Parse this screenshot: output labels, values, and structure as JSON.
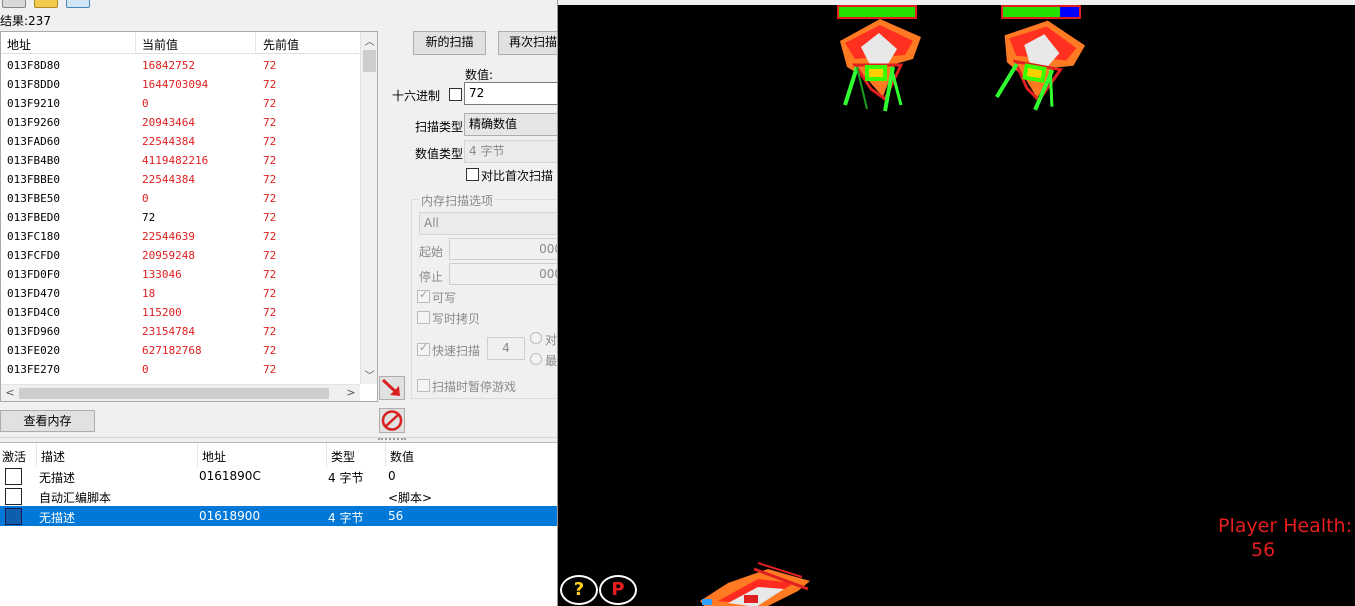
{
  "ce": {
    "results_label": "结果:237",
    "scan_list": {
      "columns": [
        "地址",
        "当前值",
        "先前值"
      ],
      "rows": [
        {
          "address": "013F8D80",
          "current": "16842752",
          "previous": "72",
          "changed": true
        },
        {
          "address": "013F8DD0",
          "current": "1644703094",
          "previous": "72",
          "changed": true
        },
        {
          "address": "013F9210",
          "current": "0",
          "previous": "72",
          "changed": true
        },
        {
          "address": "013F9260",
          "current": "20943464",
          "previous": "72",
          "changed": true
        },
        {
          "address": "013FAD60",
          "current": "22544384",
          "previous": "72",
          "changed": true
        },
        {
          "address": "013FB4B0",
          "current": "4119482216",
          "previous": "72",
          "changed": true
        },
        {
          "address": "013FBBE0",
          "current": "22544384",
          "previous": "72",
          "changed": true
        },
        {
          "address": "013FBE50",
          "current": "0",
          "previous": "72",
          "changed": true
        },
        {
          "address": "013FBED0",
          "current": "72",
          "previous": "72",
          "changed": false
        },
        {
          "address": "013FC180",
          "current": "22544639",
          "previous": "72",
          "changed": true
        },
        {
          "address": "013FCFD0",
          "current": "20959248",
          "previous": "72",
          "changed": true
        },
        {
          "address": "013FD0F0",
          "current": "133046",
          "previous": "72",
          "changed": true
        },
        {
          "address": "013FD470",
          "current": "18",
          "previous": "72",
          "changed": true
        },
        {
          "address": "013FD4C0",
          "current": "115200",
          "previous": "72",
          "changed": true
        },
        {
          "address": "013FD960",
          "current": "23154784",
          "previous": "72",
          "changed": true
        },
        {
          "address": "013FE020",
          "current": "627182768",
          "previous": "72",
          "changed": true
        },
        {
          "address": "013FE270",
          "current": "0",
          "previous": "72",
          "changed": true
        }
      ]
    },
    "buttons": {
      "new_scan": "新的扫描",
      "next_scan": "再次扫描",
      "view_memory": "查看内存"
    },
    "value_label": "数值:",
    "hex_label": "十六进制",
    "value_input": "72",
    "scan_type_label": "扫描类型",
    "scan_type_value": "精确数值",
    "value_type_label": "数值类型",
    "value_type_value": "4 字节",
    "compare_first_label": "对比首次扫描",
    "memory_options": {
      "title": "内存扫描选项",
      "region": "All",
      "start_label": "起始",
      "start_value": "000",
      "stop_label": "停止",
      "stop_value": "000",
      "writable_label": "可写",
      "copy_on_write_label": "写时拷贝",
      "fast_scan_label": "快速扫描",
      "fast_scan_value": "4",
      "align_label": "对",
      "last_digits_label": "最",
      "pause_label": "扫描时暂停游戏"
    },
    "address_list": {
      "columns": [
        "激活",
        "描述",
        "地址",
        "类型",
        "数值"
      ],
      "rows": [
        {
          "description": "无描述",
          "address": "0161890C",
          "type": "4 字节",
          "value": "0",
          "selected": false
        },
        {
          "description": "自动汇编脚本",
          "address": "",
          "type": "",
          "value": "<脚本>",
          "selected": false
        },
        {
          "description": "无描述",
          "address": "01618900",
          "type": "4 字节",
          "value": "56",
          "selected": true
        }
      ]
    }
  },
  "game": {
    "enemies": [
      {
        "health_fraction": 1.0
      },
      {
        "health_fraction": 0.75
      }
    ],
    "health_label": "Player Health:",
    "health_value": "56",
    "help_button": "?",
    "pause_button": "P",
    "colors": {
      "health_text": "#e61e1e",
      "hp_fill": "#22e000",
      "hp_empty": "#0000ff",
      "hp_border": "#e02020"
    }
  }
}
